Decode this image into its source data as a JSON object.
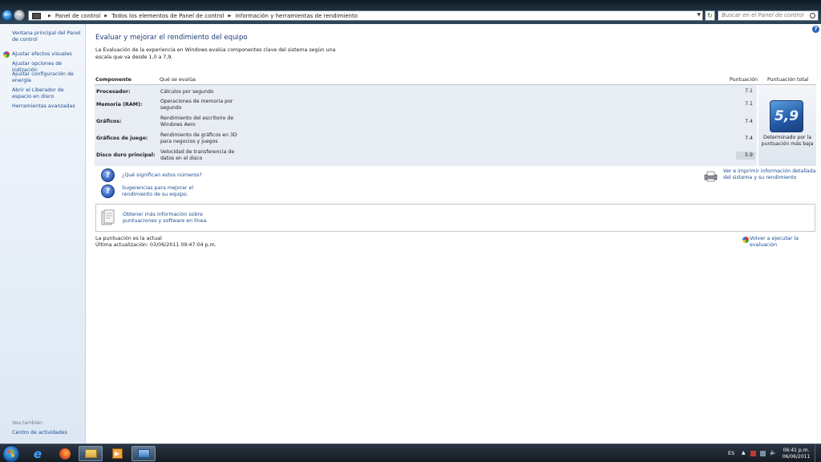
{
  "address_bar": {
    "crumbs": [
      "Panel de control",
      "Todos los elementos de Panel de control",
      "Información y herramientas de rendimiento"
    ],
    "search_placeholder": "Buscar en el Panel de control"
  },
  "sidebar": {
    "items": [
      {
        "label": "Ventana principal del Panel de control"
      },
      {
        "label": "Ajustar efectos visuales"
      },
      {
        "label": "Ajustar opciones de indización"
      },
      {
        "label": "Ajustar configuración de energía"
      },
      {
        "label": "Abrir el Liberador de espacio en disco"
      },
      {
        "label": "Herramientas avanzadas"
      }
    ],
    "see_also": "Vea también",
    "see_also_link": "Centro de actividades"
  },
  "main": {
    "title": "Evaluar y mejorar el rendimiento del equipo",
    "intro": "La Evaluación de la experiencia en Windows evalúa componentes clave del sistema según una escala que va desde 1,0 a 7,9.",
    "headers": {
      "component": "Componente",
      "rated": "Qué se evalúa",
      "subscore": "Puntuación",
      "base_score": "Puntuación total"
    },
    "rows": [
      {
        "component": "Procesador:",
        "desc": "Cálculos por segundo",
        "score": "7.1"
      },
      {
        "component": "Memoria (RAM):",
        "desc": "Operaciones de memoria por segundo",
        "score": "7.1"
      },
      {
        "component": "Gráficos:",
        "desc": "Rendimiento del escritorio de Windows Aero",
        "score": "7.4"
      },
      {
        "component": "Gráficos de juego:",
        "desc": "Rendimiento de gráficos en 3D para negocios y juegos",
        "score": "7.4"
      },
      {
        "component": "Disco duro principal:",
        "desc": "Velocidad de transferencia de datos en el disco",
        "score": "5.9"
      }
    ],
    "base_score": "5,9",
    "base_caption": "Determinado por la puntuación más baja",
    "links": {
      "numbers": "¿Qué significan estos números?",
      "tips": "Sugerencias para mejorar el rendimiento de su equipo.",
      "print": "Ver e imprimir información detallada del sistema y su rendimiento",
      "more_info": "Obtener más información sobre puntuaciones y software en línea",
      "rerun": "Volver a ejecutar la evaluación"
    },
    "status": {
      "current": "La puntuación es la actual",
      "last_update": "Última actualización: 03/06/2011 09:47:04 p.m."
    }
  },
  "taskbar": {
    "language": "ES",
    "time": "06:41 p.m.",
    "date": "06/06/2011"
  }
}
